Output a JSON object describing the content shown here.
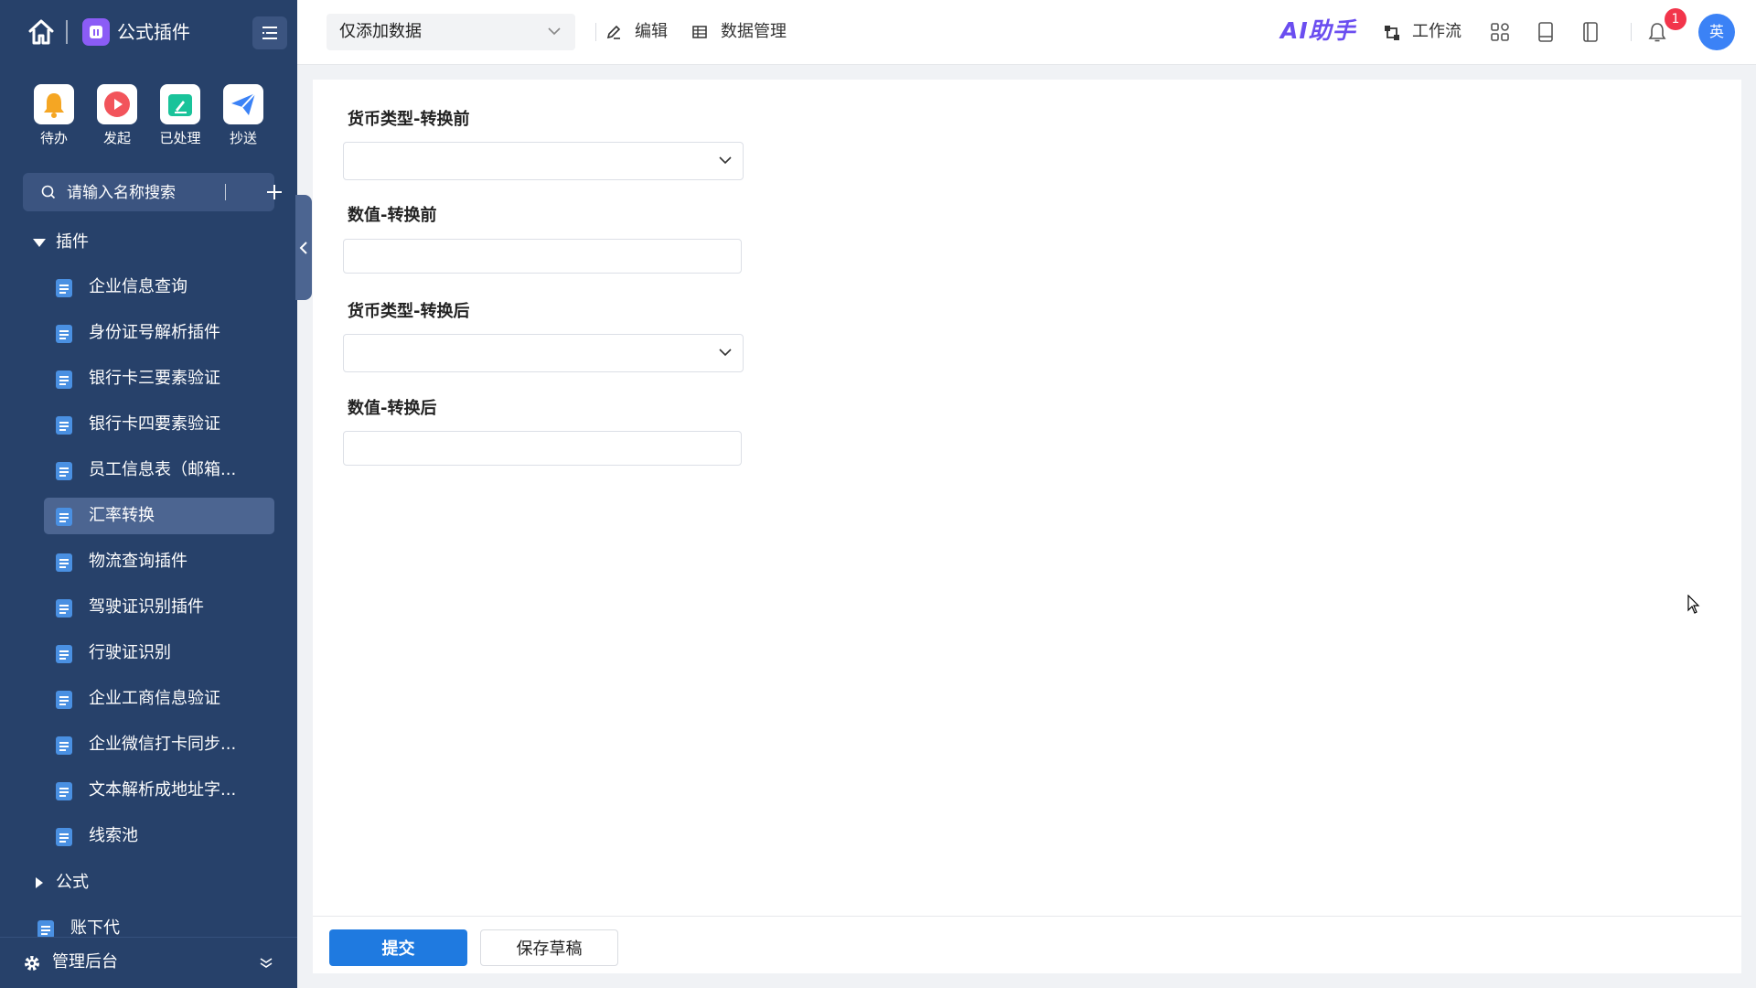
{
  "app": {
    "title": "公式插件"
  },
  "quick_actions": [
    {
      "label": "待办",
      "icon": "bell-icon",
      "color": "#f5a623"
    },
    {
      "label": "发起",
      "icon": "play-icon",
      "color": "#f2545b"
    },
    {
      "label": "已处理",
      "icon": "edit-icon",
      "color": "#19c39a"
    },
    {
      "label": "抄送",
      "icon": "send-icon",
      "color": "#3b82f6"
    }
  ],
  "sidebar": {
    "search_placeholder": "请输入名称搜索",
    "groups": [
      {
        "label": "插件",
        "expanded": true
      },
      {
        "label": "公式",
        "expanded": false
      }
    ],
    "items": [
      {
        "label": "企业信息查询"
      },
      {
        "label": "身份证号解析插件"
      },
      {
        "label": "银行卡三要素验证"
      },
      {
        "label": "银行卡四要素验证"
      },
      {
        "label": "员工信息表（邮箱..."
      },
      {
        "label": "汇率转换",
        "active": true
      },
      {
        "label": "物流查询插件"
      },
      {
        "label": "驾驶证识别插件"
      },
      {
        "label": "行驶证识别"
      },
      {
        "label": "企业工商信息验证"
      },
      {
        "label": "企业微信打卡同步..."
      },
      {
        "label": "文本解析成地址字..."
      },
      {
        "label": "线索池"
      }
    ],
    "partial_item": "账下代",
    "bottom_label": "管理后台"
  },
  "topbar": {
    "view_select_value": "仅添加数据",
    "edit_label": "编辑",
    "data_manage_label": "数据管理",
    "ai_label": "AI助手",
    "workflow_label": "工作流",
    "notification_count": "1",
    "avatar_text": "英"
  },
  "form": {
    "fields": [
      {
        "label": "货币类型-转换前",
        "type": "select",
        "value": ""
      },
      {
        "label": "数值-转换前",
        "type": "input",
        "value": ""
      },
      {
        "label": "货币类型-转换后",
        "type": "select",
        "value": ""
      },
      {
        "label": "数值-转换后",
        "type": "input",
        "value": ""
      }
    ],
    "submit_label": "提交",
    "draft_label": "保存草稿"
  },
  "colors": {
    "sidebar_bg": "#27416a",
    "active_item_bg": "#4c6591",
    "primary": "#1f7ae0",
    "badge": "#f2354b",
    "ai_brand": "#6b4ef0"
  }
}
